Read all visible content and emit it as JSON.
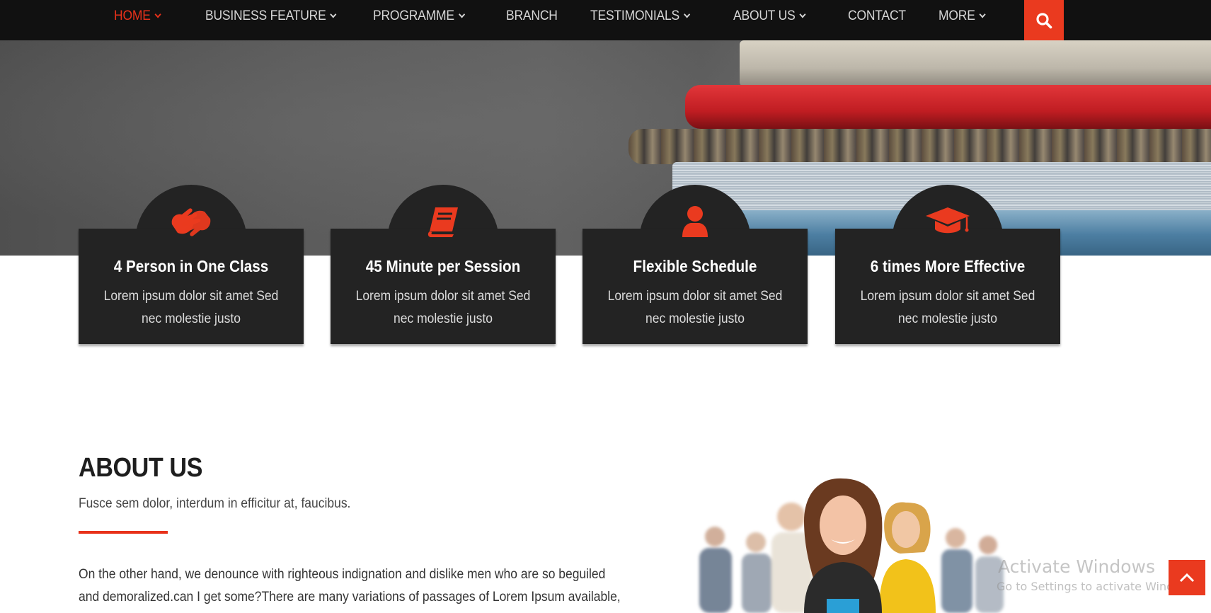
{
  "nav": {
    "items": [
      {
        "label": "HOME",
        "dropdown": true,
        "active": true
      },
      {
        "label": "BUSINESS FEATURE",
        "dropdown": true
      },
      {
        "label": "PROGRAMME",
        "dropdown": true
      },
      {
        "label": "BRANCH",
        "dropdown": false
      },
      {
        "label": "TESTIMONIALS",
        "dropdown": true
      },
      {
        "label": "ABOUT US",
        "dropdown": true
      },
      {
        "label": "CONTACT",
        "dropdown": false
      },
      {
        "label": "MORE",
        "dropdown": true
      }
    ],
    "search_icon": "search-icon"
  },
  "features": [
    {
      "icon": "sign-language-icon",
      "title": "4 Person in One Class",
      "text": "Lorem ipsum dolor sit amet Sed nec molestie justo"
    },
    {
      "icon": "book-icon",
      "title": "45 Minute per Session",
      "text": "Lorem ipsum dolor sit amet Sed nec molestie justo"
    },
    {
      "icon": "user-icon",
      "title": "Flexible Schedule",
      "text": "Lorem ipsum dolor sit amet Sed nec molestie justo"
    },
    {
      "icon": "graduation-cap-icon",
      "title": "6 times More Effective",
      "text": "Lorem ipsum dolor sit amet Sed nec molestie justo"
    }
  ],
  "about": {
    "title": "ABOUT US",
    "subtitle": "Fusce sem dolor, interdum in efficitur at, faucibus.",
    "body": "On the other hand, we denounce with righteous indignation and dislike men who are so beguiled and demoralized.can I get some?There are many variations of passages of Lorem Ipsum available, but the majority have suffered alteration in some form, by injected humour, or randomised words"
  },
  "watermark": {
    "title": "Activate Windows",
    "subtitle": "Go to Settings to activate Windows."
  },
  "colors": {
    "accent": "#ea3a1f",
    "nav_bg": "#111111",
    "card_bg": "#232323"
  }
}
